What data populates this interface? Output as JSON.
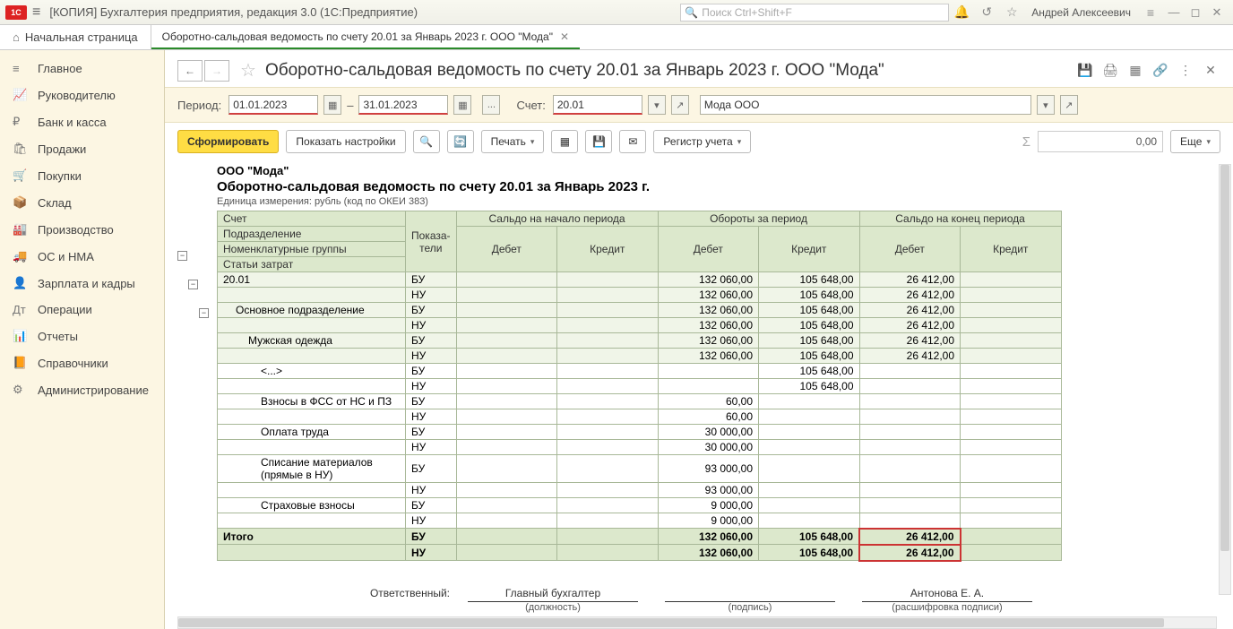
{
  "titlebar": {
    "app_title": "[КОПИЯ] Бухгалтерия предприятия, редакция 3.0  (1С:Предприятие)",
    "search_placeholder": "Поиск Ctrl+Shift+F",
    "user": "Андрей Алексеевич"
  },
  "tabs": {
    "home": "Начальная страница",
    "doc": "Оборотно-сальдовая ведомость по счету 20.01 за Январь 2023 г. ООО \"Мода\""
  },
  "sidebar": [
    {
      "icon": "≡",
      "label": "Главное"
    },
    {
      "icon": "📈",
      "label": "Руководителю"
    },
    {
      "icon": "₽",
      "label": "Банк и касса"
    },
    {
      "icon": "🛍",
      "label": "Продажи"
    },
    {
      "icon": "🛒",
      "label": "Покупки"
    },
    {
      "icon": "📦",
      "label": "Склад"
    },
    {
      "icon": "🏭",
      "label": "Производство"
    },
    {
      "icon": "🚚",
      "label": "ОС и НМА"
    },
    {
      "icon": "👤",
      "label": "Зарплата и кадры"
    },
    {
      "icon": "Дт",
      "label": "Операции"
    },
    {
      "icon": "📊",
      "label": "Отчеты"
    },
    {
      "icon": "📙",
      "label": "Справочники"
    },
    {
      "icon": "⚙",
      "label": "Администрирование"
    }
  ],
  "doc_header": {
    "title": "Оборотно-сальдовая ведомость по счету 20.01 за Январь 2023 г. ООО \"Мода\""
  },
  "params": {
    "period_label": "Период:",
    "date_from": "01.01.2023",
    "date_to": "31.01.2023",
    "account_label": "Счет:",
    "account": "20.01",
    "org": "Мода ООО",
    "ellipsis": "..."
  },
  "toolbar": {
    "form": "Сформировать",
    "show_settings": "Показать настройки",
    "print": "Печать",
    "register": "Регистр учета",
    "sum": "0,00",
    "more": "Еще"
  },
  "report": {
    "org": "ООО \"Мода\"",
    "title": "Оборотно-сальдовая ведомость по счету 20.01 за Январь 2023 г.",
    "unit": "Единица измерения: рубль (код по ОКЕИ 383)",
    "headers": {
      "account": "Счет",
      "indicators": "Показа-\nтели",
      "saldo_begin": "Сальдо на начало периода",
      "turnover": "Обороты за период",
      "saldo_end": "Сальдо на конец периода",
      "subdiv": "Подразделение",
      "nomen": "Номенклатурные группы",
      "cost_items": "Статьи затрат",
      "debit": "Дебет",
      "credit": "Кредит"
    },
    "rows": [
      {
        "name": "20.01",
        "ind": "БУ",
        "td": "132 060,00",
        "tc": "105 648,00",
        "ed": "26 412,00",
        "sec": true
      },
      {
        "name": "",
        "ind": "НУ",
        "td": "132 060,00",
        "tc": "105 648,00",
        "ed": "26 412,00",
        "sec": true
      },
      {
        "name": "Основное подразделение",
        "ind": "БУ",
        "td": "132 060,00",
        "tc": "105 648,00",
        "ed": "26 412,00",
        "sec": true,
        "pad": 1
      },
      {
        "name": "",
        "ind": "НУ",
        "td": "132 060,00",
        "tc": "105 648,00",
        "ed": "26 412,00",
        "sec": true,
        "pad": 1
      },
      {
        "name": "Мужская одежда",
        "ind": "БУ",
        "td": "132 060,00",
        "tc": "105 648,00",
        "ed": "26 412,00",
        "sec": true,
        "pad": 2
      },
      {
        "name": "",
        "ind": "НУ",
        "td": "132 060,00",
        "tc": "105 648,00",
        "ed": "26 412,00",
        "sec": true,
        "pad": 2
      },
      {
        "name": "<...>",
        "ind": "БУ",
        "td": "",
        "tc": "105 648,00",
        "ed": "",
        "pad": 3
      },
      {
        "name": "",
        "ind": "НУ",
        "td": "",
        "tc": "105 648,00",
        "ed": "",
        "pad": 3
      },
      {
        "name": "Взносы в ФСС от НС и ПЗ",
        "ind": "БУ",
        "td": "60,00",
        "tc": "",
        "ed": "",
        "pad": 3
      },
      {
        "name": "",
        "ind": "НУ",
        "td": "60,00",
        "tc": "",
        "ed": "",
        "pad": 3
      },
      {
        "name": "Оплата труда",
        "ind": "БУ",
        "td": "30 000,00",
        "tc": "",
        "ed": "",
        "pad": 3
      },
      {
        "name": "",
        "ind": "НУ",
        "td": "30 000,00",
        "tc": "",
        "ed": "",
        "pad": 3
      },
      {
        "name": "Списание материалов (прямые в НУ)",
        "ind": "БУ",
        "td": "93 000,00",
        "tc": "",
        "ed": "",
        "pad": 3
      },
      {
        "name": "",
        "ind": "НУ",
        "td": "93 000,00",
        "tc": "",
        "ed": "",
        "pad": 3
      },
      {
        "name": "Страховые взносы",
        "ind": "БУ",
        "td": "9 000,00",
        "tc": "",
        "ed": "",
        "pad": 3
      },
      {
        "name": "",
        "ind": "НУ",
        "td": "9 000,00",
        "tc": "",
        "ed": "",
        "pad": 3
      }
    ],
    "total_label": "Итого",
    "totals": [
      {
        "ind": "БУ",
        "td": "132 060,00",
        "tc": "105 648,00",
        "ed": "26 412,00"
      },
      {
        "ind": "НУ",
        "td": "132 060,00",
        "tc": "105 648,00",
        "ed": "26 412,00"
      }
    ],
    "signature": {
      "resp": "Ответственный:",
      "position": "Главный бухгалтер",
      "position_sub": "(должность)",
      "sign_sub": "(подпись)",
      "name": "Антонова Е. А.",
      "name_sub": "(расшифровка подписи)"
    }
  }
}
